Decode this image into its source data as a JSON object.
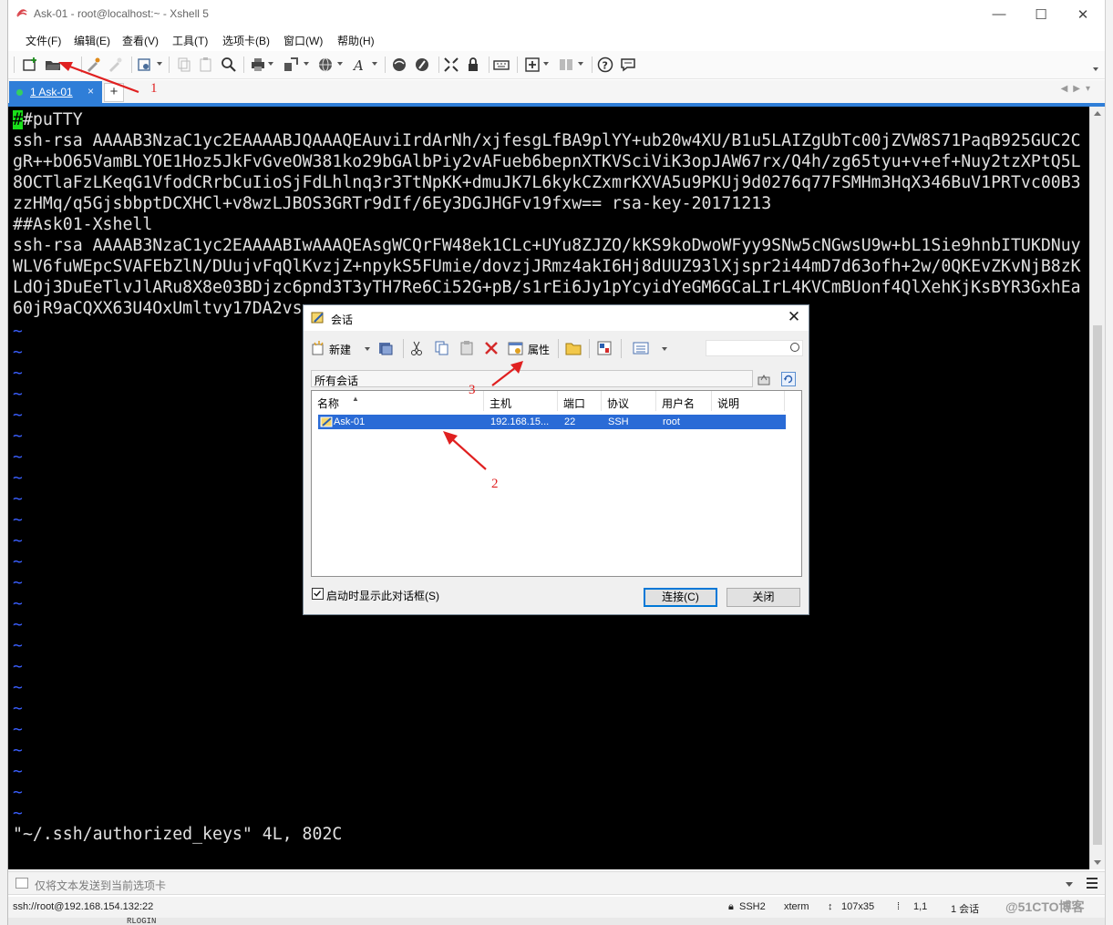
{
  "window": {
    "title": "Ask-01 - root@localhost:~ - Xshell 5",
    "controls": {
      "minimize": "—",
      "maximize": "☐",
      "close": "✕"
    }
  },
  "menubar": [
    "文件(F)",
    "编辑(E)",
    "查看(V)",
    "工具(T)",
    "选项卡(B)",
    "窗口(W)",
    "帮助(H)"
  ],
  "toolbar": {
    "icons": [
      "new-session-icon",
      "open-session-icon",
      "reconnect-icon",
      "disconnect-icon",
      "properties-icon",
      "copy-icon",
      "paste-icon",
      "find-icon",
      "print-icon",
      "transfer-icon",
      "globe-icon",
      "font-icon",
      "xftp-icon",
      "script-icon",
      "fullscreen-icon",
      "lock-icon",
      "keyboard-icon",
      "compose-icon",
      "layout-icon",
      "help-icon",
      "chat-icon"
    ]
  },
  "tabs": {
    "active_label": "1 Ask-01",
    "close": "×",
    "add": "+"
  },
  "terminal": {
    "cursor_char": "#",
    "lines": [
      "#puTTY",
      "ssh-rsa AAAAB3NzaC1yc2EAAAABJQAAAQEAuviIrdArNh/xjfesgLfBA9plYY+ub20w4XU/B1u5LAIZgUbTc00jZVW8S71PaqB925GUC2C",
      "gR++bO65VamBLYOE1Hoz5JkFvGveOW381ko29bGAlbPiy2vAFueb6bepnXTKVSciViK3opJAW67rx/Q4h/zg65tyu+v+ef+Nuy2tzXPtQ5L",
      "8OCTlaFzLKeqG1VfodCRrbCuIioSjFdLhlnq3r3TtNpKK+dmuJK7L6kykCZxmrKXVA5u9PKUj9d0276q77FSMHm3HqX346BuV1PRTvc00B3",
      "zzHMq/q5GjsbbptDCXHCl+v8wzLJBOS3GRTr9dIf/6Ey3DGJHGFv19fxw== rsa-key-20171213",
      "##Ask01-Xshell",
      "ssh-rsa AAAAB3NzaC1yc2EAAAABIwAAAQEAsgWCQrFW48ek1CLc+UYu8ZJZO/kKS9koDwoWFyy9SNw5cNGwsU9w+bL1Sie9hnbITUKDNuy",
      "WLV6fuWEpcSVAFEbZlN/DUujvFqQlKvzjZ+npykS5FUmie/dovzjJRmz4akI6Hj8dUUZ93lXjspr2i44mD7d63ofh+2w/0QKEvZKvNjB8zK",
      "LdOj3DuEeTlvJlARu8X8e03BDjzc6pnd3T3yTH7Re6Ci52G+pB/s1rEi6Jy1pYcyidYeGM6GCaLIrL4KVCmBUonf4QlXehKjKsBYR3GxhEa",
      "60jR9aCQXX63U4OxUmltvy17DA2vs"
    ],
    "tilde": "~",
    "tilde_count": 24,
    "status": "\"~/.ssh/authorized_keys\" 4L, 802C"
  },
  "sendbar": {
    "placeholder": "仅将文本发送到当前选项卡"
  },
  "statusbar": {
    "connection": "ssh://root@192.168.154.132:22",
    "protocol": "SSH2",
    "term": "xterm",
    "size": "107x35",
    "cursor": "1,1",
    "sessions": "1 会话"
  },
  "watermark": "@51CTO博客",
  "background_fragment": "RLOGIN",
  "dialog": {
    "title": "会话",
    "close": "✕",
    "toolbar": {
      "new": "新建",
      "properties": "属性"
    },
    "path": "所有会话",
    "columns": [
      "名称",
      "主机",
      "端口",
      "协议",
      "用户名",
      "说明"
    ],
    "rows": [
      {
        "name": "Ask-01",
        "host": "192.168.15...",
        "port": "22",
        "protocol": "SSH",
        "user": "root",
        "desc": ""
      }
    ],
    "show_on_startup": "启动时显示此对话框(S)",
    "show_on_startup_checked": true,
    "connect": "连接(C)",
    "close_button": "关闭"
  },
  "annotations": {
    "a1": "1",
    "a2": "2",
    "a3": "3",
    "color": "#e02020"
  }
}
